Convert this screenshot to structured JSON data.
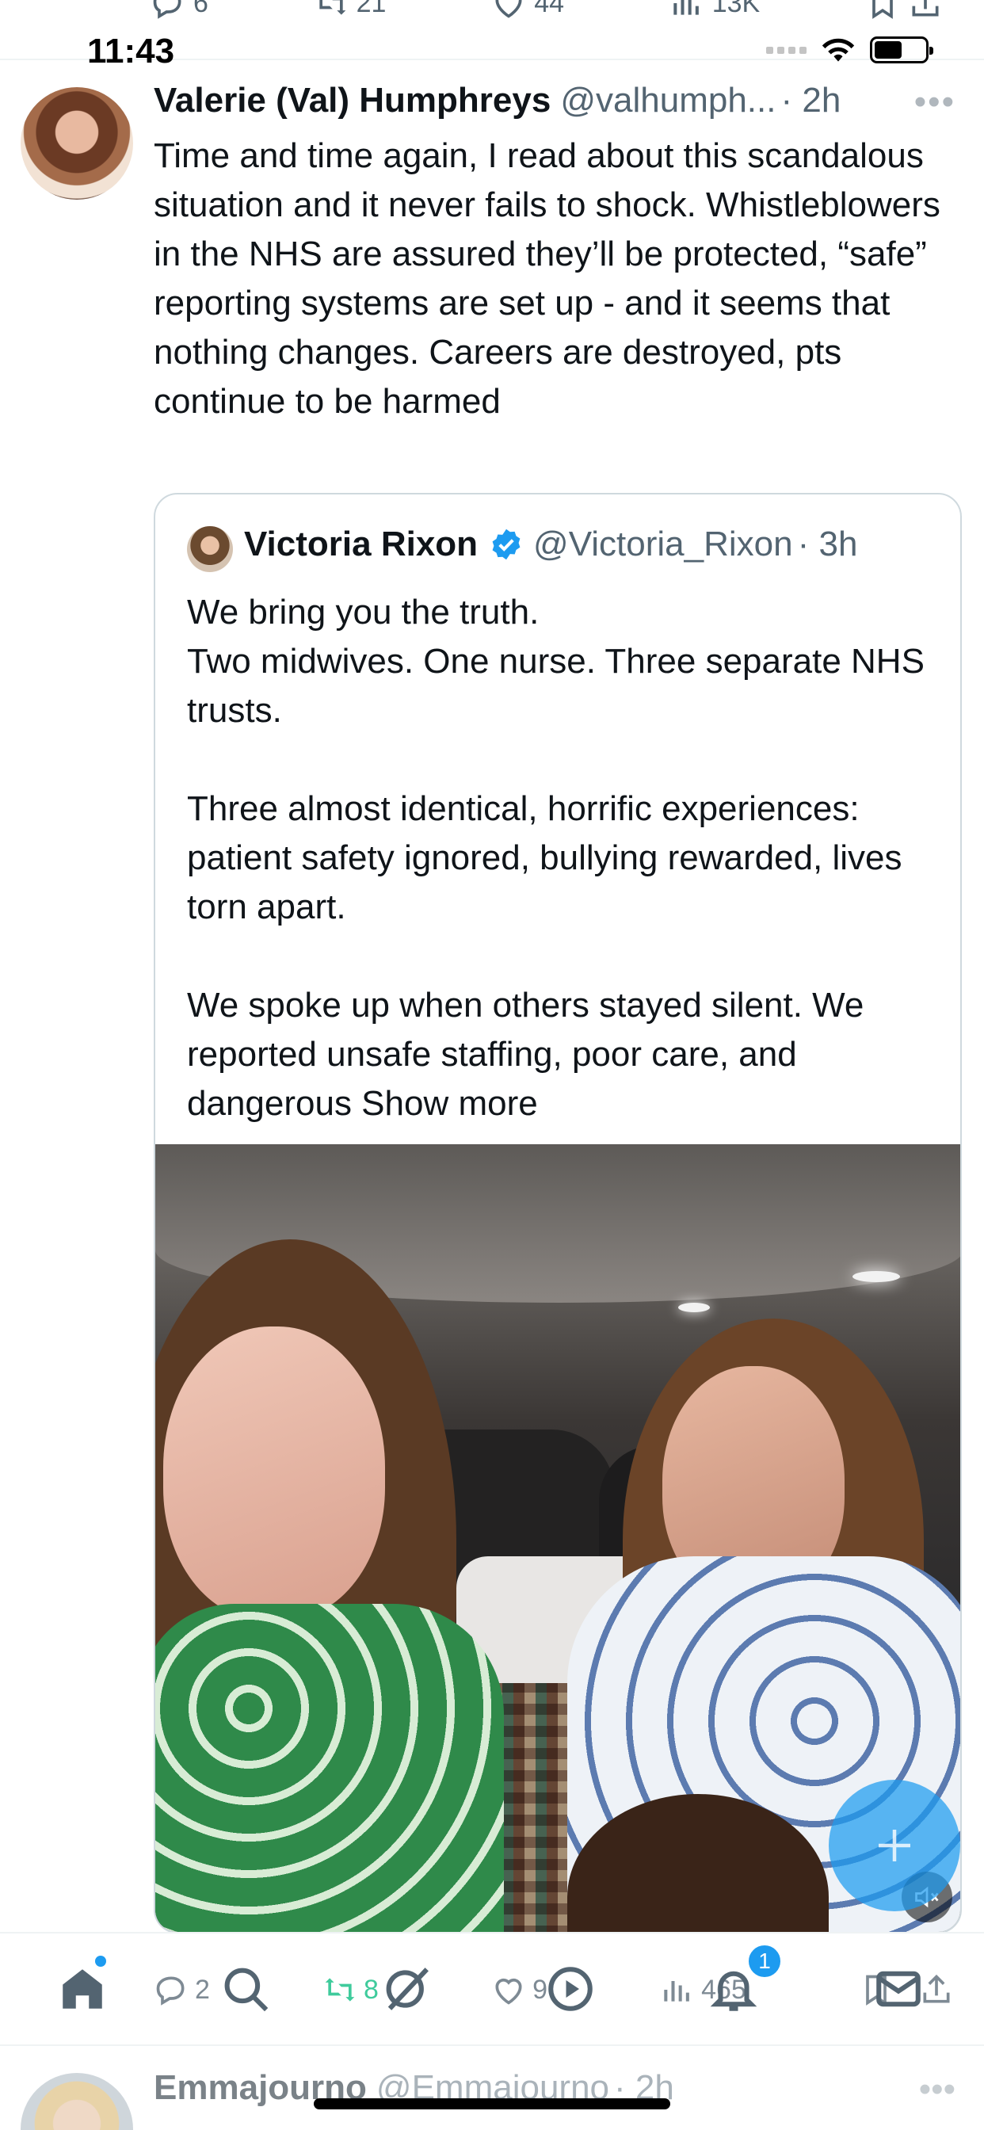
{
  "status_bar": {
    "time": "11:43"
  },
  "previous_tweet_actions": {
    "replies": "6",
    "reposts": "21",
    "likes": "44",
    "views": "13K"
  },
  "tweet": {
    "author_name": "Valerie (Val) Humphreys",
    "author_handle": "@valhumph...",
    "time": "· 2h",
    "text": "Time and time again, I read about this scandalous situation and it never fails to shock. Whistleblowers in the NHS are assured they’ll be protected, “safe”  reporting systems are set up - and it seems that nothing changes. Careers are destroyed, pts continue to be harmed",
    "actions": {
      "replies": "2",
      "reposts": "8",
      "likes": "9",
      "views": "465"
    }
  },
  "quoted_tweet": {
    "author_name": "Victoria Rixon",
    "author_handle": "@Victoria_Rixon",
    "time": "· 3h",
    "text": "We bring you the truth.\nTwo midwives. One nurse. Three separate NHS trusts.\n\nThree almost identical, horrific experiences: patient safety ignored, bullying rewarded, lives torn apart.\n\nWe spoke up when others stayed silent. We reported unsafe staffing, poor care, and dangerous ",
    "show_more": "Show more"
  },
  "nav": {
    "notification_count": "1"
  },
  "next_tweet": {
    "author_name": "Emmajourno",
    "author_handle": "@Emmajourno",
    "time": "· 2h"
  },
  "colors": {
    "accent": "#1d9bf0",
    "repost_green": "#00ba7c",
    "secondary_text": "#536471"
  },
  "icons": [
    "reply-icon",
    "repost-icon",
    "like-icon",
    "views-icon",
    "bookmark-icon",
    "share-icon",
    "verified-icon",
    "mute-icon",
    "compose-icon",
    "home-icon",
    "search-icon",
    "grok-icon",
    "spaces-icon",
    "notifications-icon",
    "messages-icon"
  ]
}
